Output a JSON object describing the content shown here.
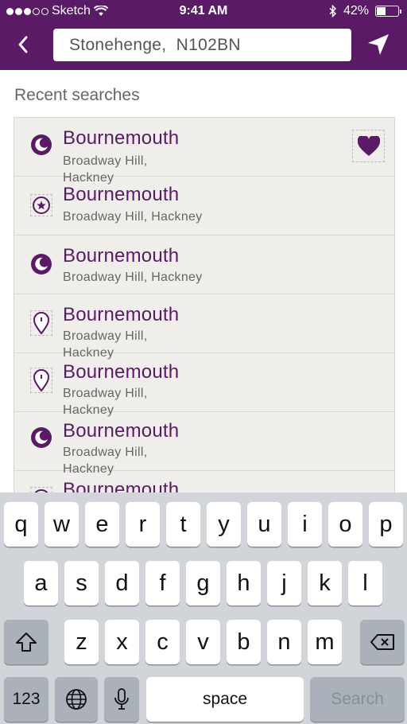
{
  "status_bar": {
    "carrier": "Sketch",
    "time": "9:41 AM",
    "battery": "42%"
  },
  "header": {
    "search_value": "Stonehenge,  N102BN"
  },
  "recent": {
    "title": "Recent searches",
    "items": [
      {
        "title": "Bournemouth",
        "sub": "Broadway Hill, Hackney",
        "icon": "moon-icon",
        "favorite": true
      },
      {
        "title": "Bournemouth",
        "sub": "Broadway Hill, Hackney",
        "icon": "star-icon"
      },
      {
        "title": "Bournemouth",
        "sub": "Broadway Hill, Hackney",
        "icon": "moon-icon"
      },
      {
        "title": "Bournemouth",
        "sub": "Broadway Hill, Hackney",
        "icon": "pin-icon"
      },
      {
        "title": "Bournemouth",
        "sub": "Broadway Hill, Hackney",
        "icon": "pin-icon"
      },
      {
        "title": "Bournemouth",
        "sub": "Broadway Hill, Hackney",
        "icon": "moon-icon"
      },
      {
        "title": "Bournemouth",
        "sub": "",
        "icon": "star-icon"
      }
    ]
  },
  "keyboard": {
    "row1": [
      "q",
      "w",
      "e",
      "r",
      "t",
      "y",
      "u",
      "i",
      "o",
      "p"
    ],
    "row2": [
      "a",
      "s",
      "d",
      "f",
      "g",
      "h",
      "j",
      "k",
      "l"
    ],
    "row3": [
      "z",
      "x",
      "c",
      "v",
      "b",
      "n",
      "m"
    ],
    "numbers_label": "123",
    "space_label": "space",
    "search_label": "Search"
  },
  "colors": {
    "brand": "#5a1a66",
    "list_bg": "#f0eeea",
    "keyboard_bg": "#d1d4d9"
  }
}
